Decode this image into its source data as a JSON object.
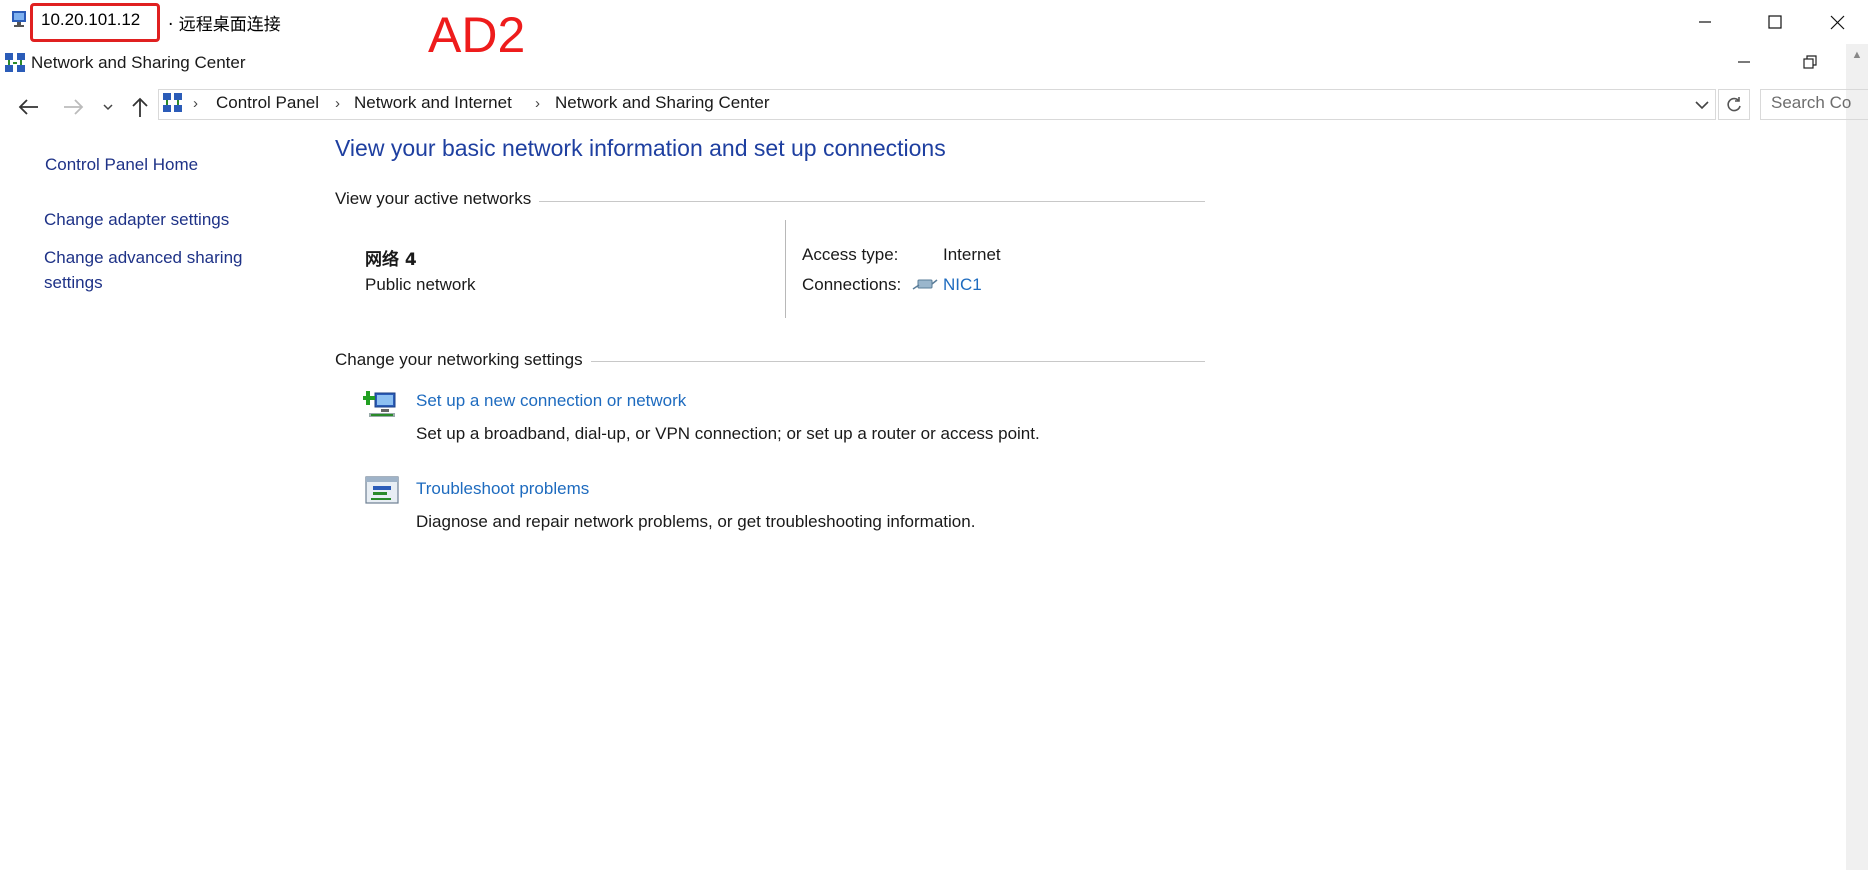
{
  "rdp_window": {
    "ip_address": "10.20.101.12",
    "title": "· 远程桌面连接",
    "annotation_label": "AD2"
  },
  "window": {
    "title": "Network and Sharing Center"
  },
  "address_bar": {
    "breadcrumbs": [
      "Control Panel",
      "Network and Internet",
      "Network and Sharing Center"
    ],
    "search_placeholder": "Search Co"
  },
  "left_pane": {
    "home_link": "Control Panel Home",
    "links": [
      "Change adapter settings",
      "Change advanced sharing settings"
    ]
  },
  "main": {
    "title": "View your basic network information and set up connections",
    "active_networks_heading": "View your active networks",
    "network": {
      "name": "网络  4",
      "type": "Public network",
      "access_type_label": "Access type:",
      "access_type_value": "Internet",
      "connections_label": "Connections:",
      "connections_value": "NIC1"
    },
    "settings_heading": "Change your networking settings",
    "tasks": [
      {
        "title": "Set up a new connection or network",
        "description": "Set up a broadband, dial-up, or VPN connection; or set up a router or access point.",
        "icon": "new-connection-icon"
      },
      {
        "title": "Troubleshoot problems",
        "description": "Diagnose and repair network problems, or get troubleshooting information.",
        "icon": "troubleshoot-icon"
      }
    ]
  },
  "colors": {
    "title_blue": "#1e3fa0",
    "link_blue": "#1e6bbf",
    "nav_link": "#1e3287",
    "annotation_red": "#ee1c1c"
  }
}
